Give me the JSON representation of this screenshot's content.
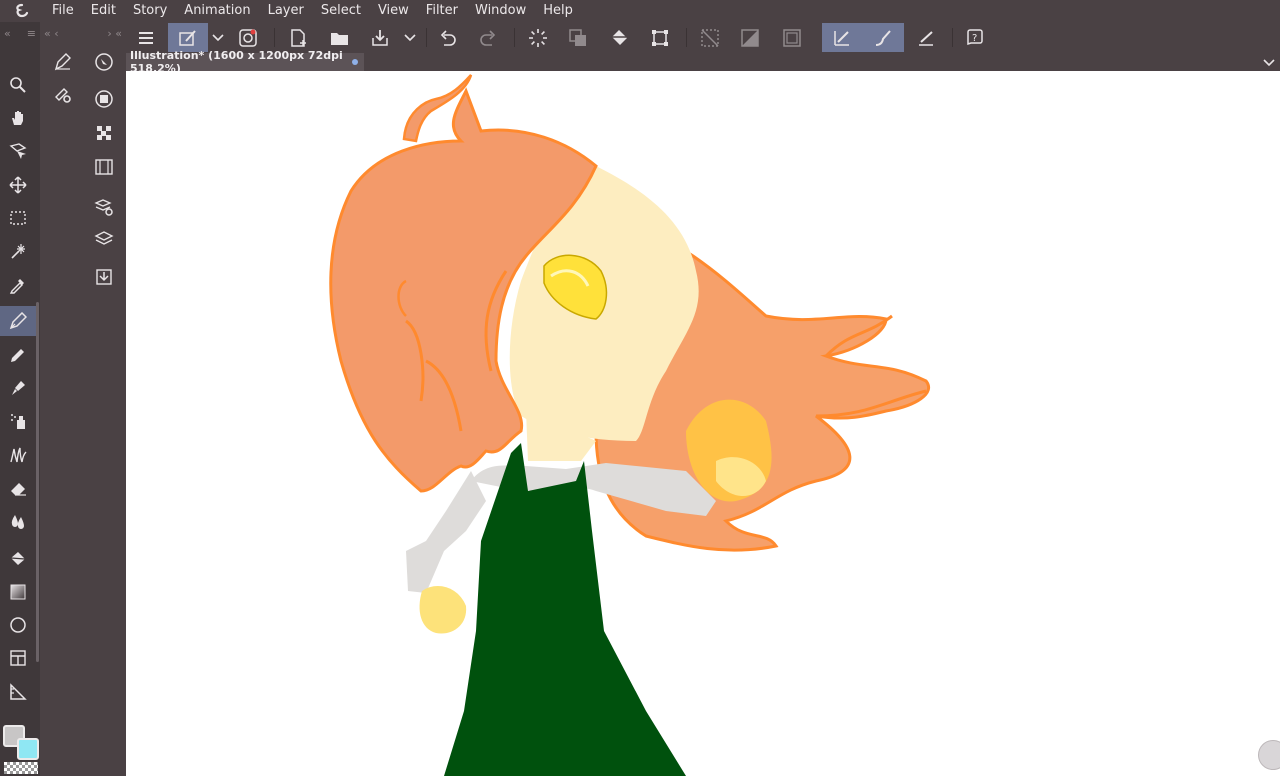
{
  "menu": [
    "File",
    "Edit",
    "Story",
    "Animation",
    "Layer",
    "Select",
    "View",
    "Filter",
    "Window",
    "Help"
  ],
  "document": {
    "tab_title": "Illustration* (1600 x 1200px 72dpi 518.2%)"
  },
  "command_bar": {
    "icons": [
      "menu-icon",
      "edit-pen-icon",
      "dropdown-icon",
      "companion-icon",
      "new-file-icon",
      "open-folder-icon",
      "save-icon",
      "dropdown-icon",
      "undo-icon",
      "redo-icon",
      "loading-icon",
      "layer-transfer-icon",
      "fill-icon",
      "transform-icon",
      "deselect-icon",
      "invert-selection-icon",
      "show-selection-icon",
      "pen-snap-icon",
      "brush-snap-icon",
      "ruler-snap-icon",
      "help-icon"
    ]
  },
  "tools": [
    "zoom-icon",
    "hand-icon",
    "operation-icon",
    "move-layer-icon",
    "selection-icon",
    "auto-select-icon",
    "eyedropper-icon",
    "pen-icon",
    "pencil-icon",
    "brush-icon",
    "airbrush-icon",
    "decoration-icon",
    "eraser-icon",
    "blend-icon",
    "fill-bucket-icon",
    "gradient-icon",
    "figure-icon",
    "frame-icon",
    "ruler-icon"
  ],
  "palette_icons": [
    "sub-tool-icon",
    "tool-property-icon",
    "navigator-icon",
    "color-circle-icon",
    "material-icon",
    "timeline-icon",
    "layer-property-icon",
    "layer-icon",
    "auto-action-icon"
  ],
  "colors": {
    "main_color": "#c8c6c6",
    "sub_color": "#8fe7f3",
    "ui_dark": "#4a4144",
    "ui_active": "#6f7898"
  }
}
